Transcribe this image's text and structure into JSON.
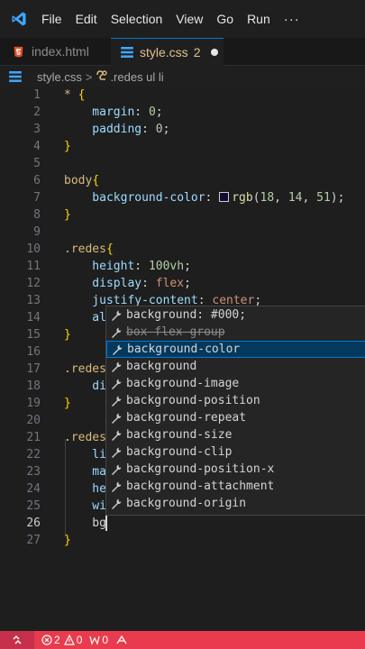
{
  "menu": {
    "items": [
      "File",
      "Edit",
      "Selection",
      "View",
      "Go",
      "Run"
    ],
    "more": "···"
  },
  "tabs": [
    {
      "label": "index.html",
      "icon": "html-file-icon",
      "active": false
    },
    {
      "label": "style.css",
      "icon": "css-file-icon",
      "active": true,
      "problems": "2",
      "dirty": true
    }
  ],
  "breadcrumb": {
    "file": "style.css",
    "separator": ">",
    "symbol": ".redes ul li"
  },
  "editor": {
    "active_line": "26",
    "lines": [
      {
        "n": "1",
        "tokens": [
          {
            "t": "* ",
            "c": "sel"
          },
          {
            "t": "{",
            "c": "br"
          }
        ]
      },
      {
        "n": "2",
        "tokens": [
          {
            "t": "    margin",
            "c": "prop"
          },
          {
            "t": ": ",
            "c": ""
          },
          {
            "t": "0",
            "c": "num"
          },
          {
            "t": ";",
            "c": ""
          }
        ]
      },
      {
        "n": "3",
        "tokens": [
          {
            "t": "    padding",
            "c": "prop"
          },
          {
            "t": ": ",
            "c": ""
          },
          {
            "t": "0",
            "c": "num"
          },
          {
            "t": ";",
            "c": ""
          }
        ]
      },
      {
        "n": "4",
        "tokens": [
          {
            "t": "}",
            "c": "br"
          }
        ]
      },
      {
        "n": "5",
        "tokens": []
      },
      {
        "n": "6",
        "tokens": [
          {
            "t": "body",
            "c": "sel"
          },
          {
            "t": "{",
            "c": "br"
          }
        ]
      },
      {
        "n": "7",
        "tokens": [
          {
            "t": "    background-color",
            "c": "prop"
          },
          {
            "t": ": ",
            "c": ""
          },
          {
            "t": "#swatch",
            "c": "swatch"
          },
          {
            "t": "rgb",
            "c": "kw"
          },
          {
            "t": "(",
            "c": ""
          },
          {
            "t": "18",
            "c": "num"
          },
          {
            "t": ", ",
            "c": ""
          },
          {
            "t": "14",
            "c": "num"
          },
          {
            "t": ", ",
            "c": ""
          },
          {
            "t": "51",
            "c": "num"
          },
          {
            "t": ");",
            "c": ""
          }
        ]
      },
      {
        "n": "8",
        "tokens": [
          {
            "t": "}",
            "c": "br"
          }
        ]
      },
      {
        "n": "9",
        "tokens": []
      },
      {
        "n": "10",
        "tokens": [
          {
            "t": ".redes",
            "c": "sel"
          },
          {
            "t": "{",
            "c": "br"
          }
        ]
      },
      {
        "n": "11",
        "tokens": [
          {
            "t": "    height",
            "c": "prop"
          },
          {
            "t": ": ",
            "c": ""
          },
          {
            "t": "100vh",
            "c": "num"
          },
          {
            "t": ";",
            "c": ""
          }
        ]
      },
      {
        "n": "12",
        "tokens": [
          {
            "t": "    display",
            "c": "prop"
          },
          {
            "t": ": ",
            "c": ""
          },
          {
            "t": "flex",
            "c": "val"
          },
          {
            "t": ";",
            "c": ""
          }
        ]
      },
      {
        "n": "13",
        "tokens": [
          {
            "t": "    justify-content",
            "c": "prop"
          },
          {
            "t": ": ",
            "c": ""
          },
          {
            "t": "center",
            "c": "val"
          },
          {
            "t": ";",
            "c": ""
          }
        ]
      },
      {
        "n": "14",
        "tokens": [
          {
            "t": "    al",
            "c": "prop"
          }
        ]
      },
      {
        "n": "15",
        "tokens": [
          {
            "t": "}",
            "c": "br"
          }
        ]
      },
      {
        "n": "16",
        "tokens": []
      },
      {
        "n": "17",
        "tokens": [
          {
            "t": ".redes",
            "c": "sel"
          }
        ]
      },
      {
        "n": "18",
        "tokens": [
          {
            "t": "    di",
            "c": "prop"
          }
        ]
      },
      {
        "n": "19",
        "tokens": [
          {
            "t": "}",
            "c": "br"
          }
        ]
      },
      {
        "n": "20",
        "tokens": []
      },
      {
        "n": "21",
        "tokens": [
          {
            "t": ".redes",
            "c": "sel"
          }
        ]
      },
      {
        "n": "22",
        "tokens": [
          {
            "t": "    li",
            "c": "prop"
          }
        ]
      },
      {
        "n": "23",
        "tokens": [
          {
            "t": "    ma",
            "c": "prop"
          }
        ]
      },
      {
        "n": "24",
        "tokens": [
          {
            "t": "    he",
            "c": "prop"
          }
        ]
      },
      {
        "n": "25",
        "tokens": [
          {
            "t": "    wi",
            "c": "prop"
          }
        ]
      },
      {
        "n": "26",
        "tokens": [
          {
            "t": "    bg",
            "c": ""
          }
        ]
      },
      {
        "n": "27",
        "tokens": [
          {
            "t": "}",
            "c": "br"
          }
        ]
      }
    ]
  },
  "suggestions": {
    "selected_index": 2,
    "items": [
      {
        "label": "background: #000;",
        "deprecated": false
      },
      {
        "label": "box-flex-group",
        "deprecated": true
      },
      {
        "label": "background-color",
        "deprecated": false
      },
      {
        "label": "background",
        "deprecated": false
      },
      {
        "label": "background-image",
        "deprecated": false
      },
      {
        "label": "background-position",
        "deprecated": false
      },
      {
        "label": "background-repeat",
        "deprecated": false
      },
      {
        "label": "background-size",
        "deprecated": false
      },
      {
        "label": "background-clip",
        "deprecated": false
      },
      {
        "label": "background-position-x",
        "deprecated": false
      },
      {
        "label": "background-attachment",
        "deprecated": false
      },
      {
        "label": "background-origin",
        "deprecated": false
      }
    ]
  },
  "statusbar": {
    "errors": "2",
    "warnings": "0",
    "ports": "0"
  },
  "colors": {
    "statusbar": "#e83b4d",
    "accent": "#0078d4",
    "selector": "#d7ba7d",
    "property": "#9cdcfe",
    "number": "#b5cea8"
  }
}
